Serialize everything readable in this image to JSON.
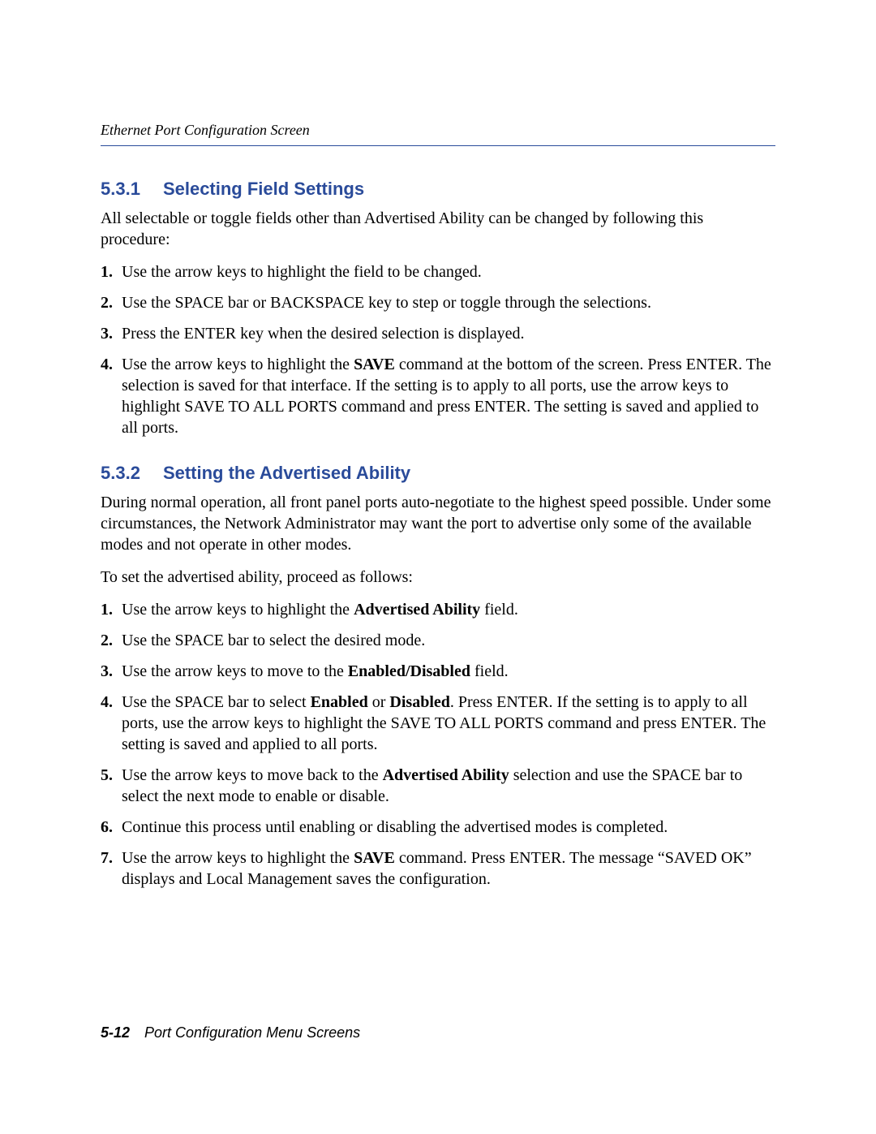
{
  "header": {
    "running_title": "Ethernet Port Configuration Screen"
  },
  "sections": {
    "s531": {
      "number": "5.3.1",
      "title": "Selecting Field Settings",
      "intro": "All selectable or toggle fields other than Advertised Ability can be changed by following this procedure:",
      "steps": {
        "s1": "Use the arrow keys to highlight the field to be changed.",
        "s2": "Use the SPACE bar or BACKSPACE key to step or toggle through the selections.",
        "s3": "Press the ENTER key when the desired selection is displayed.",
        "s4_pre": "Use the arrow keys to highlight the ",
        "s4_bold": "SAVE",
        "s4_post": " command at the bottom of the screen. Press ENTER. The selection is saved for that interface. If the setting is to apply to all ports, use the arrow keys to highlight SAVE TO ALL PORTS command and press ENTER. The setting is saved and applied to all ports."
      }
    },
    "s532": {
      "number": "5.3.2",
      "title": "Setting the Advertised Ability",
      "intro": "During normal operation, all front panel ports auto-negotiate to the highest speed possible. Under some circumstances, the Network Administrator may want the port to advertise only some of the available modes and not operate in other modes.",
      "intro2": "To set the advertised ability, proceed as follows:",
      "steps": {
        "s1_pre": "Use the arrow keys to highlight the ",
        "s1_bold": "Advertised Ability",
        "s1_post": " field.",
        "s2": "Use the SPACE bar to select the desired mode.",
        "s3_pre": "Use the arrow keys to move to the ",
        "s3_bold": "Enabled/Disabled",
        "s3_post": " field.",
        "s4_pre": "Use the SPACE bar to select ",
        "s4_bold1": "Enabled",
        "s4_mid": " or ",
        "s4_bold2": "Disabled",
        "s4_post": ". Press ENTER. If the setting is to apply to all ports, use the arrow keys to highlight the SAVE TO ALL PORTS command and press ENTER. The setting is saved and applied to all ports.",
        "s5_pre": "Use the arrow keys to move back to the ",
        "s5_bold": "Advertised Ability",
        "s5_post": " selection and use the SPACE bar to select the next mode to enable or disable.",
        "s6": "Continue this process until enabling or disabling the advertised modes is completed.",
        "s7_pre": "Use the arrow keys to highlight the ",
        "s7_bold": "SAVE",
        "s7_post": " command. Press ENTER. The message “SAVED OK” displays and Local Management saves the configuration."
      }
    }
  },
  "footer": {
    "page_num": "5-12",
    "title": "Port Configuration Menu Screens"
  }
}
